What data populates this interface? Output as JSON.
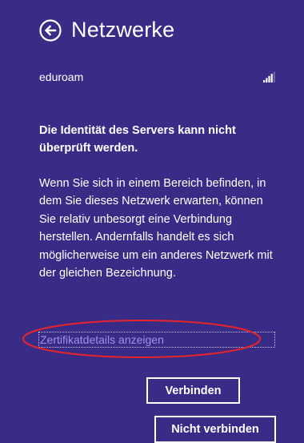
{
  "header": {
    "title": "Netzwerke",
    "back_icon": "back-arrow-circle-icon"
  },
  "network": {
    "name": "eduroam",
    "signal_icon": "wifi-signal-bars-icon",
    "signal_level": 4,
    "signal_max": 5
  },
  "message": {
    "warning": "Die Identität des Servers kann nicht überprüft werden.",
    "body": "Wenn Sie sich in einem Bereich befinden, in dem Sie dieses Netzwerk erwarten, können Sie relativ unbesorgt eine Verbindung herstellen. Andernfalls handelt es sich möglicherweise um ein anderes Netzwerk mit der gleichen Bezeichnung."
  },
  "link": {
    "certificate_details": "Zertifikatdetails anzeigen"
  },
  "buttons": {
    "connect": "Verbinden",
    "dont_connect": "Nicht verbinden"
  },
  "colors": {
    "background": "#392c86",
    "text": "#ffffff",
    "link": "#a48ee6",
    "annotation": "#e8242b"
  }
}
